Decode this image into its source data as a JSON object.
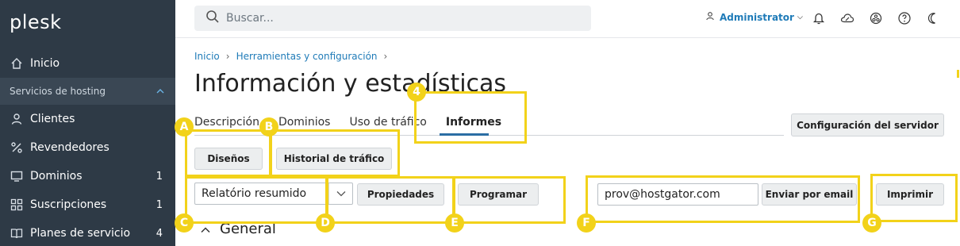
{
  "sidebar": {
    "logo": "plesk",
    "home": {
      "label": "Inicio",
      "icon": "home-icon"
    },
    "section": {
      "label": "Servicios de hosting",
      "icon": "chevron-up-icon"
    },
    "items": [
      {
        "label": "Clientes",
        "icon": "user-icon",
        "count": ""
      },
      {
        "label": "Revendedores",
        "icon": "percent-icon",
        "count": ""
      },
      {
        "label": "Dominios",
        "icon": "monitor-icon",
        "count": "1"
      },
      {
        "label": "Suscripciones",
        "icon": "grid-icon",
        "count": "1"
      },
      {
        "label": "Planes de servicio",
        "icon": "book-icon",
        "count": "4"
      }
    ]
  },
  "topbar": {
    "search_placeholder": "Buscar...",
    "user": "Administrator",
    "icons": [
      "notifications-icon",
      "cloud-icon",
      "extensions-icon",
      "help-icon",
      "dark-mode-icon"
    ]
  },
  "breadcrumb": [
    "Inicio",
    "Herramientas y configuración"
  ],
  "page_title": "Información y estadísticas",
  "tabs": [
    {
      "label": "Descripción",
      "active": false
    },
    {
      "label": "Dominios",
      "active": false
    },
    {
      "label": "Uso de tráfico",
      "active": false
    },
    {
      "label": "Informes",
      "active": true
    }
  ],
  "buttons": {
    "server_config": "Configuración del servidor",
    "designs": "Diseños",
    "traffic_history": "Historial de tráfico",
    "properties": "Propiedades",
    "schedule": "Programar",
    "send_email": "Enviar por email",
    "print": "Imprimir"
  },
  "report_select": {
    "value": "Relatório resumido"
  },
  "email_field": {
    "value": "prov@hostgator.com"
  },
  "section_title": "General",
  "annotations": {
    "color": "#f2d21a",
    "labels": [
      "4",
      "A",
      "B",
      "C",
      "D",
      "E",
      "F",
      "G"
    ]
  },
  "colors": {
    "sidebar": "#2e3a46",
    "link": "#1f7bb8",
    "accent": "#2b6ea4"
  }
}
